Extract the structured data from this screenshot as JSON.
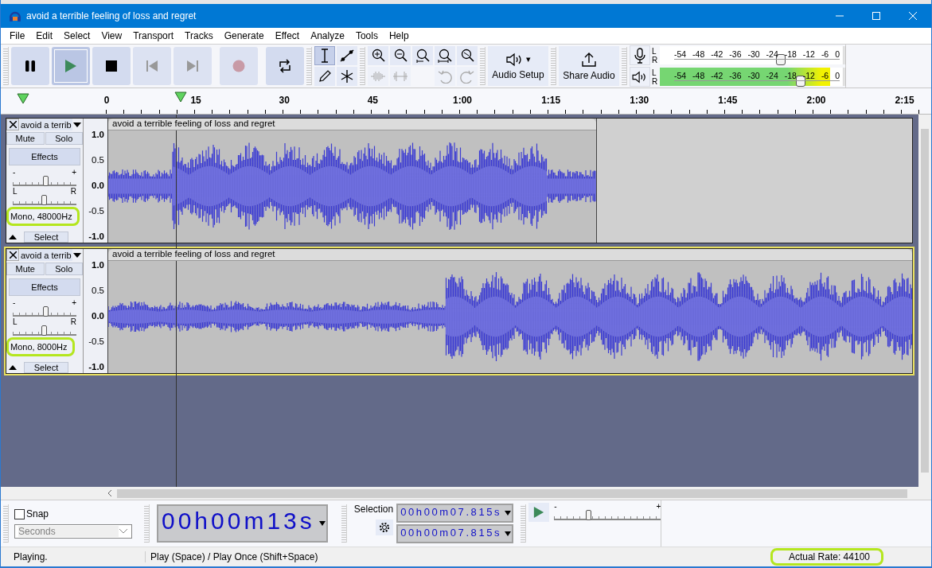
{
  "window": {
    "title": "avoid a terrible feeling of loss and regret"
  },
  "menu": [
    "File",
    "Edit",
    "Select",
    "View",
    "Transport",
    "Tracks",
    "Generate",
    "Effect",
    "Analyze",
    "Tools",
    "Help"
  ],
  "transport": [
    {
      "kind": "pause",
      "selected": false,
      "disabled": false
    },
    {
      "kind": "play",
      "selected": true,
      "disabled": false
    },
    {
      "kind": "stop",
      "selected": false,
      "disabled": false
    },
    {
      "kind": "skip_start",
      "selected": false,
      "disabled": true
    },
    {
      "kind": "skip_end",
      "selected": false,
      "disabled": true
    },
    {
      "kind": "record",
      "selected": false,
      "disabled": true
    },
    {
      "kind": "loop",
      "selected": false,
      "disabled": false
    }
  ],
  "tools": [
    {
      "kind": "select",
      "selected": true
    },
    {
      "kind": "envelope",
      "selected": false
    },
    {
      "kind": "draw",
      "selected": false
    },
    {
      "kind": "multi",
      "selected": false
    }
  ],
  "edit_tools": [
    {
      "kind": "zoom_in",
      "disabled": false
    },
    {
      "kind": "zoom_out",
      "disabled": false
    },
    {
      "kind": "fit_selection",
      "disabled": false
    },
    {
      "kind": "fit_project",
      "disabled": false
    },
    {
      "kind": "zoom_toggle",
      "disabled": false
    },
    {
      "kind": "trim",
      "disabled": true
    },
    {
      "kind": "silence",
      "disabled": true
    },
    {
      "kind": "undo",
      "disabled": true
    },
    {
      "kind": "redo",
      "disabled": true
    }
  ],
  "audio_setup": {
    "label": "Audio Setup",
    "caret": "▾"
  },
  "share_audio": {
    "label": "Share Audio"
  },
  "meters": [
    {
      "kind": "record",
      "channels": [
        "L",
        "R"
      ],
      "scale": [
        "-54",
        "-48",
        "-42",
        "-36",
        "-30",
        "-24",
        "-18",
        "-12",
        "-6",
        "0"
      ],
      "slider": {
        "level": 0.66
      }
    },
    {
      "kind": "playback",
      "channels": [
        "L",
        "R"
      ],
      "scale": [
        "-54",
        "-48",
        "-42",
        "-36",
        "-30",
        "-24",
        "-18",
        "-12",
        "-6",
        "0"
      ],
      "fill": {
        "level": 0.93
      },
      "slider": {
        "level": 0.77
      }
    }
  ],
  "ruler": {
    "labels": [
      "0",
      "15",
      "30",
      "45",
      "1:00",
      "1:15",
      "1:30",
      "1:45",
      "2:00",
      "2:15"
    ]
  },
  "tracks": [
    {
      "name": "avoid a terrib",
      "selected": false,
      "mute": "Mute",
      "solo": "Solo",
      "effects": "Effects",
      "gain": {
        "min": "-",
        "max": "+",
        "level": 0.52
      },
      "pan": {
        "left": "L",
        "right": "R",
        "level": 0.5
      },
      "info": {
        "text": "Mono, 48000Hz",
        "highlighted": true
      },
      "select": "Select",
      "scale": [
        "1.0",
        "0.5",
        "0.0",
        "-0.5",
        "-1.0"
      ],
      "clip": {
        "title": "avoid a terrible feeling of loss and regret"
      }
    },
    {
      "name": "avoid a terrib",
      "selected": true,
      "mute": "Mute",
      "solo": "Solo",
      "effects": "Effects",
      "gain": {
        "min": "-",
        "max": "+",
        "level": 0.52
      },
      "pan": {
        "left": "L",
        "right": "R",
        "level": 0.5
      },
      "info": {
        "text": "Mono, 8000Hz",
        "highlighted": true
      },
      "select": "Select",
      "scale": [
        "1.0",
        "0.5",
        "0.0",
        "-0.5",
        "-1.0"
      ],
      "clip": {
        "title": "avoid a terrible feeling of loss and regret"
      }
    }
  ],
  "snap": {
    "label": "Snap",
    "checked": false,
    "unit": "Seconds",
    "disabled": true
  },
  "time": {
    "value": "00h00m13s"
  },
  "selection": {
    "label": "Selection",
    "start": "00h00m07.815s",
    "end": "00h00m07.815s"
  },
  "play_at_speed": {
    "min": "-",
    "max": "+",
    "level": 0.33
  },
  "status": {
    "state": "Playing.",
    "hint": "Play (Space) / Play Once (Shift+Space)",
    "rate": {
      "text": "Actual Rate: 44100",
      "highlighted": true
    }
  }
}
